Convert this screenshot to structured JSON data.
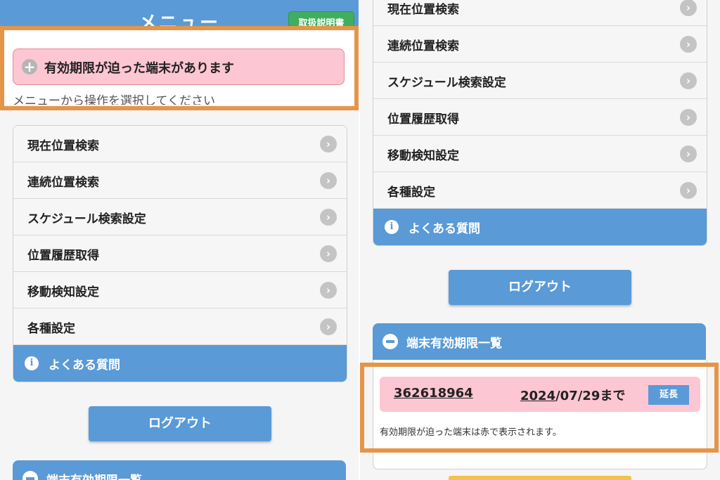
{
  "header": {
    "title": "メニュー",
    "manual_label": "取扱説明書"
  },
  "alert": {
    "text": "有効期限が迫った端末があります"
  },
  "instruction": "メニューから操作を選択してください",
  "menu": {
    "items": [
      {
        "label": "現在位置検索"
      },
      {
        "label": "連続位置検索"
      },
      {
        "label": "スケジュール検索設定"
      },
      {
        "label": "位置履歴取得"
      },
      {
        "label": "移動検知設定"
      },
      {
        "label": "各種設定"
      }
    ],
    "faq_label": "よくある質問"
  },
  "logout_label": "ログアウト",
  "expiry": {
    "title": "端末有効期限一覧",
    "device_id": "362618964",
    "date_year": "2024",
    "date_rest": "/07/29まで",
    "extend_label": "延長",
    "note": "有効期限が迫った端末は赤で表示されます。"
  }
}
